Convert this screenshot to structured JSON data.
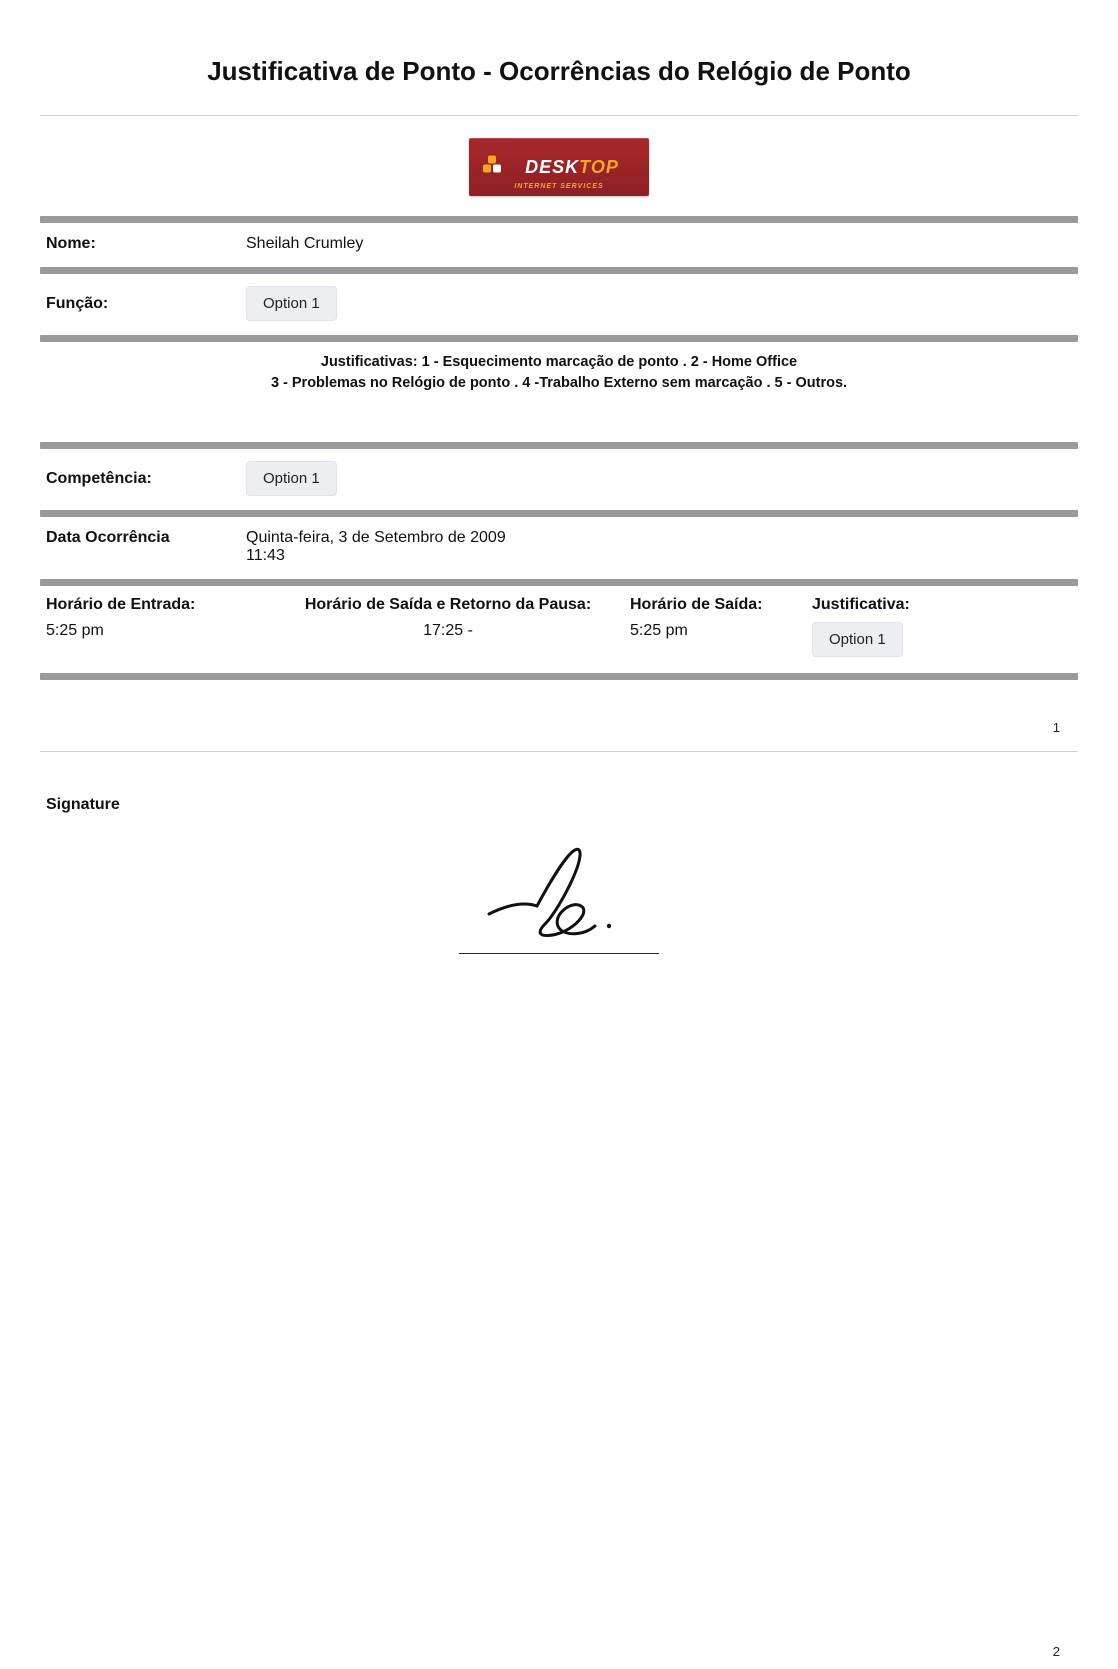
{
  "title": "Justificativa de Ponto - Ocorrências do Relógio de Ponto",
  "logo": {
    "brand_left": "DESK",
    "brand_right": "TOP",
    "sub": "INTERNET SERVICES"
  },
  "nome": {
    "label": "Nome:",
    "value": "Sheilah Crumley"
  },
  "funcao": {
    "label": "Função:",
    "option": "Option 1"
  },
  "legend": {
    "line1": "Justificativas: 1 - Esquecimento marcação de ponto . 2 - Home Office",
    "line2": "3 - Problemas no Relógio de ponto . 4 -Trabalho Externo sem marcação . 5 - Outros."
  },
  "competencia": {
    "label": "Competência:",
    "option": "Option 1"
  },
  "data_ocorrencia": {
    "label": "Data Ocorrência",
    "value_line1": "Quinta-feira, 3 de Setembro de 2009",
    "value_line2": "11:43"
  },
  "horarios": {
    "entrada": {
      "label": "Horário de Entrada:",
      "value": "5:25 pm"
    },
    "pausa": {
      "label": "Horário de Saída e Retorno da Pausa:",
      "value": "17:25 -"
    },
    "saida": {
      "label": "Horário de Saída:",
      "value": "5:25 pm"
    },
    "just": {
      "label": "Justificativa:",
      "option": "Option 1"
    }
  },
  "page1_num": "1",
  "signature_label": "Signature",
  "page2_num": "2"
}
